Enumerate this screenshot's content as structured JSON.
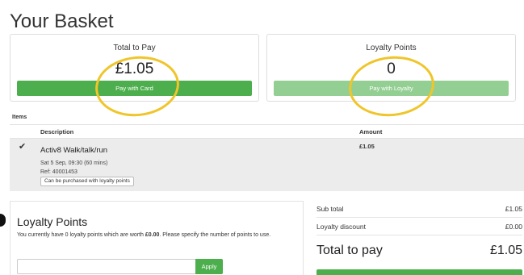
{
  "page": {
    "title": "Your Basket"
  },
  "total_card": {
    "label": "Total to Pay",
    "value": "£1.05",
    "button": "Pay with Card"
  },
  "loyalty_card": {
    "label": "Loyalty Points",
    "value": "0",
    "button": "Pay with Loyalty"
  },
  "items": {
    "section_label": "Items",
    "columns": {
      "description": "Description",
      "amount": "Amount"
    },
    "rows": [
      {
        "name": "Activ8 Walk/talk/run",
        "schedule": "Sat 5 Sep, 09:30 (60 mins)",
        "ref": "Ref: 40001453",
        "badge": "Can be purchased with loyalty points",
        "amount": "£1.05",
        "check_icon": "checkmark-icon"
      }
    ]
  },
  "loyalty_panel": {
    "title": "Loyalty Points",
    "text_before": "You currently have 0 loyalty points which are worth ",
    "text_bold": "£0.00",
    "text_after": ". Please specify the number of points to use.",
    "input_value": "",
    "apply_label": "Apply"
  },
  "summary": {
    "subtotal_label": "Sub total",
    "subtotal_value": "£1.05",
    "discount_label": "Loyalty discount",
    "discount_value": "£0.00",
    "total_label": "Total to pay",
    "total_value": "£1.05"
  },
  "colors": {
    "primary_button": "#4cae4c",
    "disabled_button": "#93cf93",
    "highlight_annotation": "#f0c52a"
  }
}
